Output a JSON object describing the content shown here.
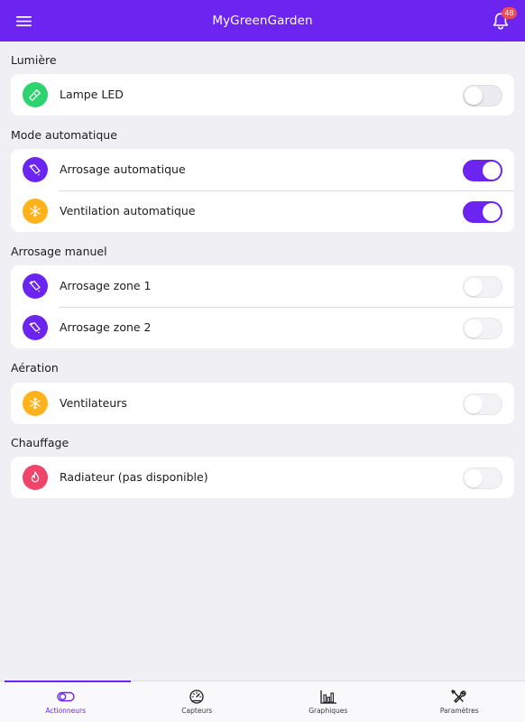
{
  "header": {
    "title": "MyGreenGarden",
    "notification_count": "48",
    "menu_icon": "menu-icon",
    "bell_icon": "bell-icon"
  },
  "colors": {
    "primary": "#6c24f0",
    "success": "#2dd36f",
    "warning": "#ffb21a",
    "danger": "#f0456a",
    "background": "#efeff4"
  },
  "sections": [
    {
      "title": "Lumière",
      "items": [
        {
          "label": "Lampe LED",
          "icon": "flashlight-icon",
          "enabled": false
        }
      ]
    },
    {
      "title": "Mode automatique",
      "items": [
        {
          "label": "Arrosage automatique",
          "icon": "watering-can-icon",
          "enabled": true
        },
        {
          "label": "Ventilation automatique",
          "icon": "snowflake-icon",
          "enabled": true
        }
      ]
    },
    {
      "title": "Arrosage manuel",
      "items": [
        {
          "label": "Arrosage zone 1",
          "icon": "watering-can-icon",
          "enabled": false
        },
        {
          "label": "Arrosage zone 2",
          "icon": "watering-can-icon",
          "enabled": false
        }
      ]
    },
    {
      "title": "Aération",
      "items": [
        {
          "label": "Ventilateurs",
          "icon": "snowflake-icon",
          "enabled": false
        }
      ]
    },
    {
      "title": "Chauffage",
      "items": [
        {
          "label": "Radiateur (pas disponible)",
          "icon": "flame-icon",
          "enabled": false
        }
      ]
    }
  ],
  "tabs": [
    {
      "label": "Actionneurs",
      "icon": "toggle-icon",
      "active": true
    },
    {
      "label": "Capteurs",
      "icon": "speedometer-icon",
      "active": false
    },
    {
      "label": "Graphiques",
      "icon": "bar-chart-icon",
      "active": false
    },
    {
      "label": "Paramètres",
      "icon": "tools-icon",
      "active": false
    }
  ]
}
